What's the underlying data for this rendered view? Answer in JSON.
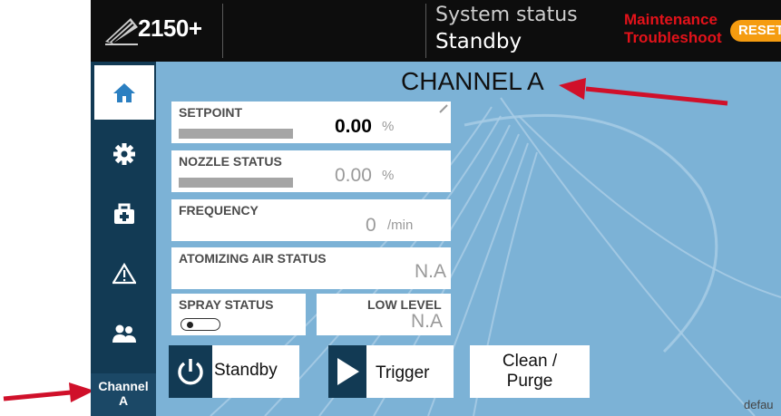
{
  "header": {
    "model": "2150+",
    "system_status_label": "System status",
    "system_status_value": "Standby",
    "alarms": [
      "Maintenance",
      "Troubleshoot"
    ],
    "reset_label": "RESET"
  },
  "sidebar": {
    "items": [
      {
        "icon": "home-icon",
        "active": true
      },
      {
        "icon": "gear-icon",
        "active": false
      },
      {
        "icon": "toolbox-icon",
        "active": false
      },
      {
        "icon": "warning-icon",
        "active": false
      },
      {
        "icon": "users-icon",
        "active": false
      }
    ],
    "channel_tab": {
      "line1": "Channel",
      "line2": "A"
    }
  },
  "main": {
    "title": "CHANNEL A",
    "setpoint": {
      "label": "SETPOINT",
      "value": "0.00",
      "unit": "%"
    },
    "nozzle_status": {
      "label": "NOZZLE STATUS",
      "value": "0.00",
      "unit": "%"
    },
    "frequency": {
      "label": "FREQUENCY",
      "value": "0",
      "unit": "/min"
    },
    "atomizing_air": {
      "label": "ATOMIZING AIR STATUS",
      "value": "N.A"
    },
    "spray_status": {
      "label": "SPRAY STATUS"
    },
    "low_level": {
      "label": "LOW LEVEL",
      "value": "N.A"
    },
    "buttons": {
      "standby": "Standby",
      "trigger": "Trigger",
      "clean_line1": "Clean /",
      "clean_line2": "Purge"
    },
    "footer_text": "defau"
  },
  "colors": {
    "header_bg": "#0d0d0d",
    "sidebar_bg": "#123a54",
    "main_bg": "#7cb2d6",
    "alarm_red": "#e3121a",
    "reset_orange": "#f59c10",
    "annotation_arrow": "#d0102a"
  }
}
